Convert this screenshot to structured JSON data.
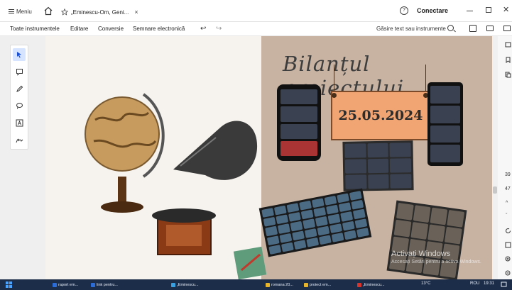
{
  "window": {
    "menu_label": "Meniu",
    "tab_title": "„Eminescu-Om, Geni...",
    "tab_close": "×",
    "help_glyph": "?",
    "connect_label": "Conectare"
  },
  "toolbar": {
    "items": [
      "Toate instrumentele",
      "Editare",
      "Conversie",
      "Semnare electronică"
    ],
    "undo": "↩",
    "redo": "↪",
    "search_label": "Găsire text sau instrumente"
  },
  "slide": {
    "title": "Bilanțul proiectului",
    "date": "25.05.2024"
  },
  "watermark": {
    "line1": "Activați Windows",
    "line2": "Accesați Setări pentru a activa Windows."
  },
  "rightbar": {
    "page_number": "39",
    "page_total": "47",
    "up": "^",
    "down": "ˇ"
  },
  "taskbar": {
    "apps": [
      "raport em...",
      "link pentru...",
      "„Eminescu...",
      "romana 20...",
      "proiect em...",
      "„Eminescu..."
    ],
    "temperature": "13°C",
    "language": "ROU",
    "time": "19:31"
  },
  "colors": {
    "slide_right_bg": "#c8b3a3",
    "date_board": "#f0a573",
    "taskbar": "#1c2d4a"
  }
}
